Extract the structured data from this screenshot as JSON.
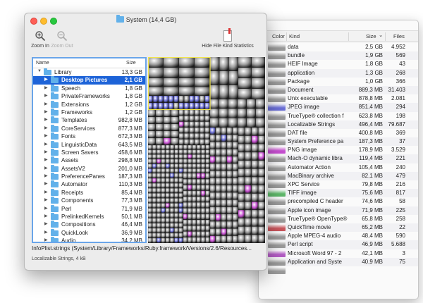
{
  "kind_window": {
    "columns": {
      "color": "Color",
      "kind": "Kind",
      "size": "Size",
      "sort_indicator": "⌄",
      "files": "Files"
    },
    "rows": [
      {
        "kind": "data",
        "size": "2,5 GB",
        "files": "4.952",
        "color": "#9a9a9a"
      },
      {
        "kind": "bundle",
        "size": "1,9 GB",
        "files": "569",
        "color": "#9a9a9a"
      },
      {
        "kind": "HEIF Image",
        "size": "1,8 GB",
        "files": "43",
        "color": "#9a9a9a"
      },
      {
        "kind": "application",
        "size": "1,3 GB",
        "files": "268",
        "color": "#9a9a9a"
      },
      {
        "kind": "Package",
        "size": "1,0 GB",
        "files": "366",
        "color": "#9a9a9a"
      },
      {
        "kind": "Document",
        "size": "889,3 MB",
        "files": "31.403",
        "color": "#9a9a9a"
      },
      {
        "kind": "Unix executable",
        "size": "878,8 MB",
        "files": "2.081",
        "color": "#9a9a9a"
      },
      {
        "kind": "JPEG image",
        "size": "851,4 MB",
        "files": "294",
        "color": "#6b6fd6"
      },
      {
        "kind": "TrueType® collection f",
        "size": "623,8 MB",
        "files": "198",
        "color": "#9a9a9a"
      },
      {
        "kind": "Localizable Strings",
        "size": "496,4 MB",
        "files": "79.687",
        "color": "#9a9a9a"
      },
      {
        "kind": "DAT file",
        "size": "400,8 MB",
        "files": "369",
        "color": "#9a9a9a"
      },
      {
        "kind": "System Preference pa",
        "size": "187,3 MB",
        "files": "37",
        "color": "#9a9a9a"
      },
      {
        "kind": "PNG image",
        "size": "178,9 MB",
        "files": "3.529",
        "color": "#c64fd0"
      },
      {
        "kind": "Mach-O dynamic libra",
        "size": "119,4 MB",
        "files": "221",
        "color": "#9a9a9a"
      },
      {
        "kind": "Automator Action",
        "size": "105,4 MB",
        "files": "240",
        "color": "#9a9a9a"
      },
      {
        "kind": "MacBinary archive",
        "size": "82,1 MB",
        "files": "479",
        "color": "#9a9a9a"
      },
      {
        "kind": "XPC Service",
        "size": "79,8 MB",
        "files": "216",
        "color": "#9a9a9a"
      },
      {
        "kind": "TIFF image",
        "size": "75,6 MB",
        "files": "817",
        "color": "#5fb86a"
      },
      {
        "kind": "precompiled C header",
        "size": "74,6 MB",
        "files": "58",
        "color": "#9a9a9a"
      },
      {
        "kind": "Apple icon image",
        "size": "71,9 MB",
        "files": "225",
        "color": "#9a9a9a"
      },
      {
        "kind": "TrueType® OpenType®",
        "size": "65,8 MB",
        "files": "258",
        "color": "#9a9a9a"
      },
      {
        "kind": "QuickTime movie",
        "size": "65,2 MB",
        "files": "22",
        "color": "#c9555c"
      },
      {
        "kind": "Apple MPEG-4 audio",
        "size": "48,4 MB",
        "files": "590",
        "color": "#9a9a9a"
      },
      {
        "kind": "Perl script",
        "size": "46,9 MB",
        "files": "5.688",
        "color": "#9a9a9a"
      },
      {
        "kind": "Microsoft Word 97 - 2",
        "size": "42,1 MB",
        "files": "3",
        "color": "#b35dc4"
      },
      {
        "kind": "Application and Syste",
        "size": "40,9 MB",
        "files": "75",
        "color": "#9a9a9a"
      },
      {
        "kind": "",
        "size": "",
        "files": "",
        "color": "#9a9a9a"
      }
    ]
  },
  "main_window": {
    "title": "System (14,4 GB)",
    "toolbar": {
      "zoom_in": "Zoom In",
      "zoom_out": "Zoom Out",
      "hide_stats": "Hide File Kind Statistics"
    },
    "tree": {
      "columns": {
        "name": "Name",
        "size": "Size"
      },
      "rows": [
        {
          "name": "Library",
          "size": "13,3 GB",
          "level": 0,
          "expanded": true,
          "selected": false
        },
        {
          "name": "Desktop Pictures",
          "size": "2,1 GB",
          "level": 1,
          "expanded": false,
          "selected": true
        },
        {
          "name": "Speech",
          "size": "1,8 GB",
          "level": 1,
          "expanded": false,
          "selected": false
        },
        {
          "name": "PrivateFrameworks",
          "size": "1,8 GB",
          "level": 1,
          "expanded": false,
          "selected": false
        },
        {
          "name": "Extensions",
          "size": "1,2 GB",
          "level": 1,
          "expanded": false,
          "selected": false
        },
        {
          "name": "Frameworks",
          "size": "1,2 GB",
          "level": 1,
          "expanded": false,
          "selected": false
        },
        {
          "name": "Templates",
          "size": "982,8 MB",
          "level": 1,
          "expanded": false,
          "selected": false
        },
        {
          "name": "CoreServices",
          "size": "877,3 MB",
          "level": 1,
          "expanded": false,
          "selected": false
        },
        {
          "name": "Fonts",
          "size": "672,3 MB",
          "level": 1,
          "expanded": false,
          "selected": false
        },
        {
          "name": "LinguisticData",
          "size": "643,5 MB",
          "level": 1,
          "expanded": false,
          "selected": false
        },
        {
          "name": "Screen Savers",
          "size": "458,6 MB",
          "level": 1,
          "expanded": false,
          "selected": false
        },
        {
          "name": "Assets",
          "size": "298,8 MB",
          "level": 1,
          "expanded": false,
          "selected": false
        },
        {
          "name": "AssetsV2",
          "size": "201,0 MB",
          "level": 1,
          "expanded": false,
          "selected": false
        },
        {
          "name": "PreferencePanes",
          "size": "187,3 MB",
          "level": 1,
          "expanded": false,
          "selected": false
        },
        {
          "name": "Automator",
          "size": "110,3 MB",
          "level": 1,
          "expanded": false,
          "selected": false
        },
        {
          "name": "Receipts",
          "size": "85,4 MB",
          "level": 1,
          "expanded": false,
          "selected": false
        },
        {
          "name": "Components",
          "size": "77,3 MB",
          "level": 1,
          "expanded": false,
          "selected": false
        },
        {
          "name": "Perl",
          "size": "71,9 MB",
          "level": 1,
          "expanded": false,
          "selected": false
        },
        {
          "name": "PrelinkedKernels",
          "size": "50,1 MB",
          "level": 1,
          "expanded": false,
          "selected": false
        },
        {
          "name": "Compositions",
          "size": "46,4 MB",
          "level": 1,
          "expanded": false,
          "selected": false
        },
        {
          "name": "QuickLook",
          "size": "36,9 MB",
          "level": 1,
          "expanded": false,
          "selected": false
        },
        {
          "name": "Audio",
          "size": "34,2 MB",
          "level": 1,
          "expanded": false,
          "selected": false
        }
      ]
    },
    "path": "InfoPlist.strings (System/Library/Frameworks/Ruby.framework/Versions/2.6/Resources...",
    "status": "Localizable Strings, 4 kB",
    "treemap_colors": {
      "normal": "#9a9a9a",
      "jpeg": "#6b6fd6",
      "png": "#c64fd0",
      "tiff": "#5fb86a",
      "selection": "#f2e64b"
    }
  }
}
